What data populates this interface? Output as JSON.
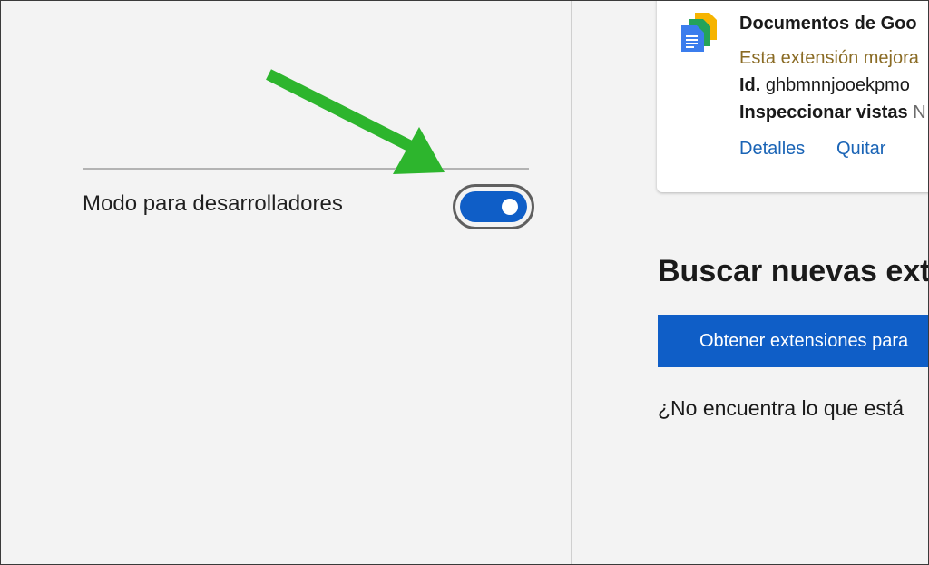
{
  "left_panel": {
    "developer_mode_label": "Modo para desarrolladores",
    "developer_mode_on": true
  },
  "extension_card": {
    "name": "Documentos de Goo",
    "description": "Esta extensión mejora",
    "id_label": "Id.",
    "id_value": "ghbmnnjooekpmo",
    "inspect_label": "Inspeccionar vistas",
    "inspect_value": "N",
    "details_link": "Detalles",
    "remove_link": "Quitar"
  },
  "find_section": {
    "heading": "Buscar nuevas ext",
    "get_button": "Obtener extensiones para",
    "not_found_text": "¿No encuentra lo que está"
  },
  "colors": {
    "toggle_on": "#0f5ec7",
    "button_bg": "#0f5ec7",
    "link": "#1a64b6",
    "description": "#8a6b24",
    "annotation_arrow": "#2db52d"
  },
  "icons": {
    "extension_icon": "google-docs-icon",
    "annotation": "green-arrow-icon"
  }
}
